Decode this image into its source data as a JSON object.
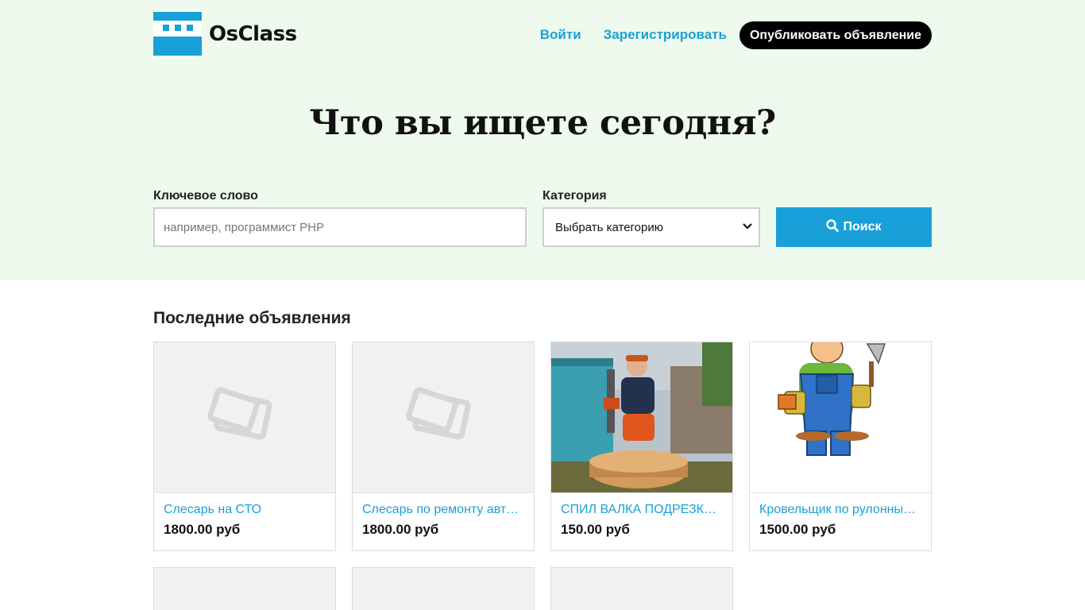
{
  "brand": {
    "name": "OsClass"
  },
  "nav": {
    "login": "Войти",
    "register": "Зарегистрировать",
    "publish": "Опубликовать объявление"
  },
  "hero": {
    "headline": "Что вы ищете сегодня?"
  },
  "search": {
    "keyword_label": "Ключевое слово",
    "keyword_placeholder": "например, программист PHP",
    "keyword_value": "",
    "category_label": "Категория",
    "category_selected": "Выбрать категорию",
    "button_label": "Поиск",
    "button_icon": "search-icon"
  },
  "latest": {
    "title": "Последние объявления",
    "items": [
      {
        "title": "Слесарь на СТО",
        "price": "1800.00 руб",
        "image": "placeholder-icon"
      },
      {
        "title": "Слесарь по ремонту автомобилей",
        "price": "1800.00 руб",
        "image": "placeholder-icon"
      },
      {
        "title": "СПИЛ ВАЛКА ПОДРЕЗКА ДЕРЕВЬЕВ",
        "price": "150.00 руб",
        "image": "photo-tree-cutting"
      },
      {
        "title": "Кровельщик по рулонным кровлям",
        "price": "1500.00 руб",
        "image": "illustration-builder"
      }
    ]
  },
  "colors": {
    "accent": "#1aa0d8",
    "hero_bg": "#eefaee",
    "publish_bg": "#000000"
  }
}
